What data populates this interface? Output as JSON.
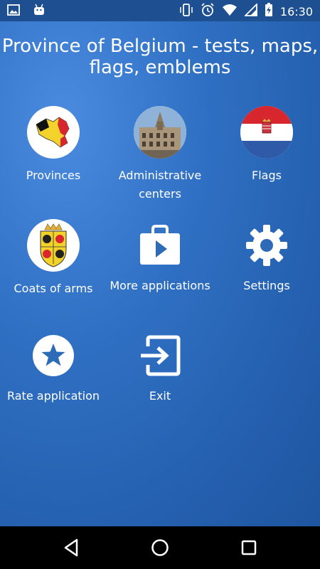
{
  "status_bar": {
    "time": "16:30",
    "left_icons": [
      "image-icon",
      "android-icon"
    ],
    "right_icons": [
      "vibrate-icon",
      "alarm-icon",
      "wifi-icon",
      "signal-icon",
      "battery-icon"
    ]
  },
  "app": {
    "title": "Province of Belgium - tests, maps, flags, emblems",
    "background_color": "#2d6bb7",
    "menu": [
      {
        "label": "Provinces",
        "icon": "belgium-map-icon"
      },
      {
        "label": "Administrative centers",
        "icon": "city-hall-photo-icon"
      },
      {
        "label": "Flags",
        "icon": "flag-icon"
      },
      {
        "label": "Coats of arms",
        "icon": "coat-of-arms-icon"
      },
      {
        "label": "More applications",
        "icon": "play-store-icon"
      },
      {
        "label": "Settings",
        "icon": "gear-icon"
      },
      {
        "label": "Rate application",
        "icon": "star-icon"
      },
      {
        "label": "Exit",
        "icon": "exit-icon"
      }
    ]
  },
  "nav_bar": {
    "buttons": [
      "back-icon",
      "home-icon",
      "recents-icon"
    ]
  }
}
